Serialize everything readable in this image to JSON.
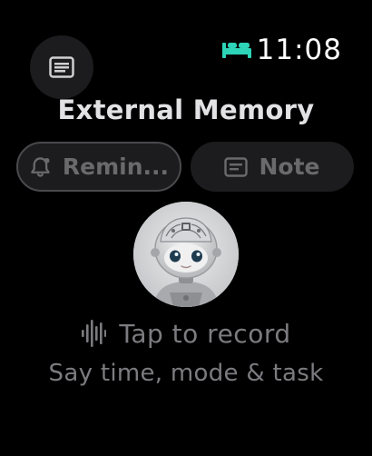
{
  "status": {
    "time": "11:08",
    "sleep_icon_color": "#2dd4b8"
  },
  "menu": {
    "icon": "list-icon"
  },
  "title": "External Memory",
  "actions": {
    "remind_label": "Remin...",
    "remind_icon": "bell-icon",
    "note_label": "Note",
    "note_icon": "note-icon"
  },
  "avatar": {
    "description_icon": "robot-avatar"
  },
  "record": {
    "label": "Tap to record",
    "icon": "waveform-icon"
  },
  "hint": "Say time, mode & task",
  "colors": {
    "background": "#000000",
    "pill": "#1c1c1e",
    "accent": "#2dd4b8",
    "muted_text": "#7c7c80"
  }
}
